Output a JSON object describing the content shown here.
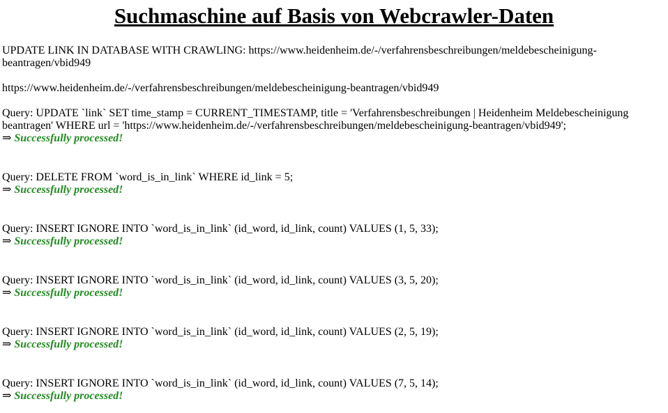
{
  "title": "Suchmaschine auf Basis von Webcrawler-Daten",
  "update_line": "UPDATE LINK IN DATABASE WITH CRAWLING: https://www.heidenheim.de/-/verfahrensbeschreibungen/meldebescheinigung-beantragen/vbid949",
  "url_line": "https://www.heidenheim.de/-/verfahrensbeschreibungen/meldebescheinigung-beantragen/vbid949",
  "arrow": "⇒",
  "success_text": "Successfully processed!",
  "queries": [
    {
      "text": "Query: UPDATE `link` SET time_stamp = CURRENT_TIMESTAMP, title = 'Verfahrensbeschreibungen | Heidenheim Meldebescheinigung beantragen' WHERE url = 'https://www.heidenheim.de/-/verfahrensbeschreibungen/meldebescheinigung-beantragen/vbid949';"
    },
    {
      "text": "Query: DELETE FROM `word_is_in_link` WHERE id_link = 5;"
    },
    {
      "text": "Query: INSERT IGNORE INTO `word_is_in_link` (id_word, id_link, count) VALUES (1, 5, 33);"
    },
    {
      "text": "Query: INSERT IGNORE INTO `word_is_in_link` (id_word, id_link, count) VALUES (3, 5, 20);"
    },
    {
      "text": "Query: INSERT IGNORE INTO `word_is_in_link` (id_word, id_link, count) VALUES (2, 5, 19);"
    },
    {
      "text": "Query: INSERT IGNORE INTO `word_is_in_link` (id_word, id_link, count) VALUES (7, 5, 14);"
    }
  ]
}
